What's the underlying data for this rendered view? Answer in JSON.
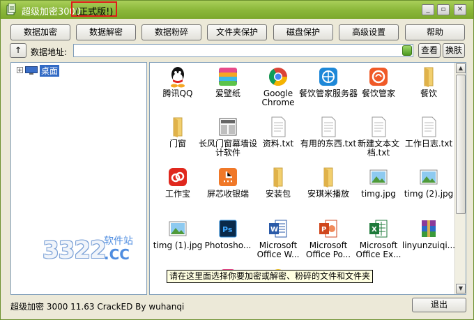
{
  "window": {
    "title": "超级加密3000",
    "edition": "(正式版!)",
    "controls": {
      "minimize": "_",
      "restore": "▫",
      "close": "✕"
    }
  },
  "toolbar": {
    "buttons": [
      "数据加密",
      "数据解密",
      "数据粉碎",
      "文件夹保护",
      "磁盘保护",
      "高级设置",
      "帮助"
    ]
  },
  "address": {
    "up_label": "↑",
    "label": "数据地址:",
    "value": "",
    "view_button": "查看",
    "skin_button": "换肤"
  },
  "tree": {
    "expander": "+",
    "root_label": "桌面"
  },
  "watermark": {
    "number": "3322",
    "domain": ".CC",
    "tagline": "软件站"
  },
  "files": [
    {
      "label": "腾讯QQ",
      "icon": "qq-icon"
    },
    {
      "label": "爱壁纸",
      "icon": "wallpaper-app-icon"
    },
    {
      "label": "Google Chrome",
      "icon": "chrome-icon"
    },
    {
      "label": "餐饮管家服务器",
      "icon": "server-app-icon"
    },
    {
      "label": "餐饮管家",
      "icon": "restaurant-app-icon"
    },
    {
      "label": "餐饮",
      "icon": "folder-icon"
    },
    {
      "label": "门窗",
      "icon": "folder-icon"
    },
    {
      "label": "长风门窗幕墙设计软件",
      "icon": "window-app-icon"
    },
    {
      "label": "资料.txt",
      "icon": "text-file-icon"
    },
    {
      "label": "有用的东西.txt",
      "icon": "text-file-icon"
    },
    {
      "label": "新建文本文档.txt",
      "icon": "text-file-icon"
    },
    {
      "label": "工作日志.txt",
      "icon": "text-file-icon"
    },
    {
      "label": "工作宝",
      "icon": "work-app-icon"
    },
    {
      "label": "屏芯收银端",
      "icon": "cashier-app-icon"
    },
    {
      "label": "安装包",
      "icon": "folder-icon"
    },
    {
      "label": "安琪米播放",
      "icon": "folder-icon"
    },
    {
      "label": "timg.jpg",
      "icon": "image-file-icon"
    },
    {
      "label": "timg (2).jpg",
      "icon": "image-file-icon"
    },
    {
      "label": "timg (1).jpg",
      "icon": "image-file-icon"
    },
    {
      "label": "Photosho...",
      "icon": "photoshop-icon"
    },
    {
      "label": "Microsoft Office W...",
      "icon": "word-icon"
    },
    {
      "label": "Microsoft Office Po...",
      "icon": "powerpoint-icon"
    },
    {
      "label": "Microsoft Office Ex...",
      "icon": "excel-icon"
    },
    {
      "label": "linyunzuiqi...",
      "icon": "winrar-icon"
    }
  ],
  "tooltip": "请在这里面选择你要加密或解密、粉碎的文件和文件夹",
  "statusbar": {
    "text": "超级加密 3000 11.63  CrackED By wuhanqi",
    "exit_button": "退出"
  }
}
